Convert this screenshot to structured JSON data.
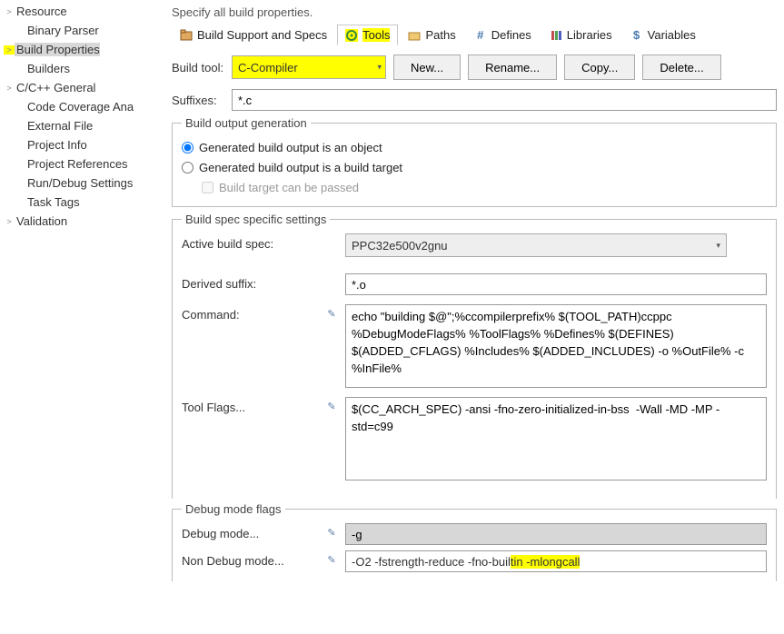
{
  "sidebar": {
    "items": [
      {
        "label": "Resource",
        "chev": ">",
        "indent": 0
      },
      {
        "label": "Binary Parser",
        "chev": "",
        "indent": 1
      },
      {
        "label": "Build Properties",
        "chev": ">",
        "indent": 0,
        "selected": true,
        "highlight": true
      },
      {
        "label": "Builders",
        "chev": "",
        "indent": 1
      },
      {
        "label": "C/C++ General",
        "chev": ">",
        "indent": 0
      },
      {
        "label": "Code Coverage Ana",
        "chev": "",
        "indent": 1
      },
      {
        "label": "External File",
        "chev": "",
        "indent": 1
      },
      {
        "label": "Project Info",
        "chev": "",
        "indent": 1
      },
      {
        "label": "Project References",
        "chev": "",
        "indent": 1
      },
      {
        "label": "Run/Debug Settings",
        "chev": "",
        "indent": 1
      },
      {
        "label": "Task Tags",
        "chev": "",
        "indent": 1
      },
      {
        "label": "Validation",
        "chev": ">",
        "indent": 0
      }
    ]
  },
  "header": {
    "specify": "Specify all build properties."
  },
  "tabs": [
    {
      "label": "Build Support and Specs"
    },
    {
      "label": "Tools",
      "active": true,
      "highlight": true
    },
    {
      "label": "Paths"
    },
    {
      "label": "Defines"
    },
    {
      "label": "Libraries"
    },
    {
      "label": "Variables"
    }
  ],
  "buildTool": {
    "label": "Build tool:",
    "value": "C-Compiler",
    "buttons": {
      "new": "New...",
      "rename": "Rename...",
      "copy": "Copy...",
      "delete": "Delete..."
    }
  },
  "suffixes": {
    "label": "Suffixes:",
    "value": "*.c"
  },
  "outputGen": {
    "legend": "Build output generation",
    "opt1": "Generated build output is an object",
    "opt2": "Generated build output is a build target",
    "check": "Build target can be passed"
  },
  "spec": {
    "legend": "Build spec specific settings",
    "activeSpecLabel": "Active build spec:",
    "activeSpecValue": "PPC32e500v2gnu",
    "derivedLabel": "Derived suffix:",
    "derivedValue": "*.o",
    "commandLabel": "Command:",
    "commandValue": "echo \"building $@\";%ccompilerprefix% $(TOOL_PATH)ccppc %DebugModeFlags% %ToolFlags% %Defines% $(DEFINES) $(ADDED_CFLAGS) %Includes% $(ADDED_INCLUDES) -o %OutFile% -c %InFile%",
    "toolFlagsLabel": "Tool Flags...",
    "toolFlagsValue": "$(CC_ARCH_SPEC) -ansi -fno-zero-initialized-in-bss  -Wall -MD -MP -std=c99"
  },
  "debug": {
    "legend": "Debug mode flags",
    "debugLabel": "Debug mode...",
    "debugValue": "-g",
    "nonDebugLabel": "Non Debug mode...",
    "nonDebugPrefix": "-O2 -fstrength-reduce -fno-buil",
    "nonDebugHighlighted": "tin -mlongcall"
  }
}
